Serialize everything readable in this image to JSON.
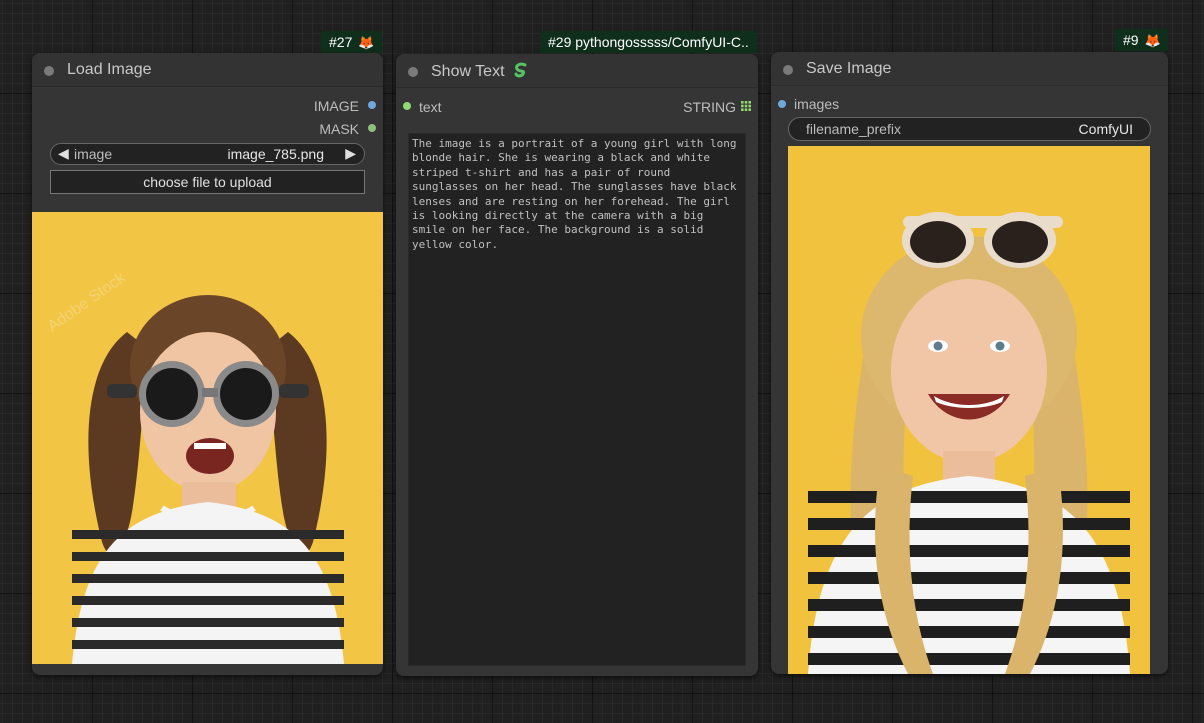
{
  "nodes": {
    "load_image": {
      "badge_id": "#27",
      "title": "Load Image",
      "outputs": [
        {
          "label": "IMAGE",
          "color": "#6fa8dc"
        },
        {
          "label": "MASK",
          "color": "#8fbf7a"
        }
      ],
      "image_widget": {
        "label": "image",
        "value": "image_785.png"
      },
      "upload_button": "choose file to upload",
      "watermark": "Adobe Stock"
    },
    "show_text": {
      "badge_text": "#29 pythongosssss/ComfyUI-C..",
      "title": "Show Text",
      "title_icon": "snake-icon",
      "input": {
        "label": "text",
        "color": "#8fd96f"
      },
      "output": {
        "label": "STRING",
        "color": "#8fd96f"
      },
      "text": "The image is a portrait of a young girl with long blonde hair. She is wearing a black and white striped t-shirt and has a pair of round sunglasses on her head. The sunglasses have black lenses and are resting on her forehead. The girl is looking directly at the camera with a big smile on her face. The background is a solid yellow color."
    },
    "save_image": {
      "badge_id": "#9",
      "title": "Save Image",
      "input": {
        "label": "images",
        "color": "#6fa8dc"
      },
      "filename_widget": {
        "label": "filename_prefix",
        "value": "ComfyUI"
      }
    }
  },
  "colors": {
    "canvas": "#202020",
    "node_body": "#353535",
    "badge": "#0f2f1c",
    "photo_background": "#f1c542"
  },
  "icons": {
    "badge": "fox-icon",
    "combo_left": "arrow-left-icon",
    "combo_right": "arrow-right-icon",
    "string_output": "grid-icon"
  }
}
